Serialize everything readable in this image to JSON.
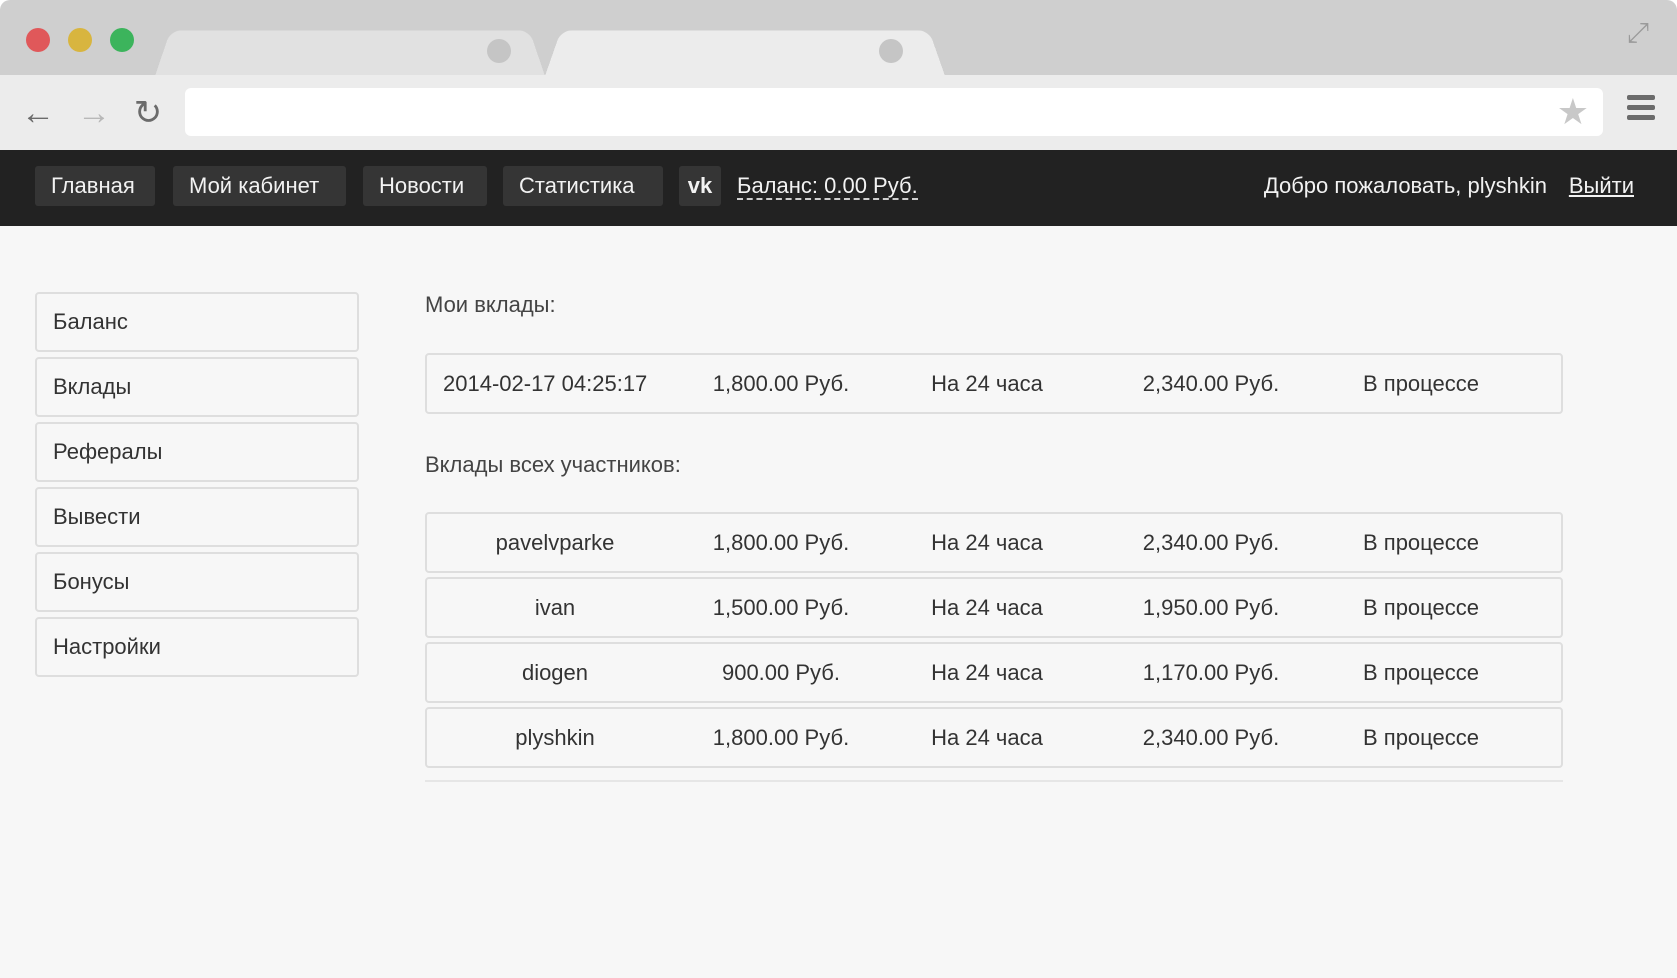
{
  "nav": {
    "home": "Главная",
    "cabinet": "Мой кабинет",
    "news": "Новости",
    "stats": "Статистика",
    "vk": "vk",
    "balance": "Баланс: 0.00 Руб.",
    "welcome": "Добро пожаловать, plyshkin",
    "logout": "Выйти"
  },
  "sidebar": {
    "items": [
      {
        "label": "Баланс"
      },
      {
        "label": "Вклады"
      },
      {
        "label": "Рефералы"
      },
      {
        "label": "Вывести"
      },
      {
        "label": "Бонусы"
      },
      {
        "label": "Настройки"
      }
    ]
  },
  "my_deposits": {
    "title": "Мои вклады:",
    "rows": [
      {
        "date": "2014-02-17 04:25:17",
        "amount": "1,800.00 Руб.",
        "term": "На 24 часа",
        "payout": "2,340.00 Руб.",
        "status": "В процессе"
      }
    ]
  },
  "all_deposits": {
    "title": "Вклады всех участников:",
    "rows": [
      {
        "user": "pavelvparke",
        "amount": "1,800.00 Руб.",
        "term": "На 24 часа",
        "payout": "2,340.00 Руб.",
        "status": "В процессе"
      },
      {
        "user": "ivan",
        "amount": "1,500.00 Руб.",
        "term": "На 24 часа",
        "payout": "1,950.00 Руб.",
        "status": "В процессе"
      },
      {
        "user": "diogen",
        "amount": "900.00 Руб.",
        "term": "На 24 часа",
        "payout": "1,170.00 Руб.",
        "status": "В процессе"
      },
      {
        "user": "plyshkin",
        "amount": "1,800.00 Руб.",
        "term": "На 24 часа",
        "payout": "2,340.00 Руб.",
        "status": "В процессе"
      }
    ]
  },
  "icons": [
    "back-arrow-icon",
    "forward-arrow-icon",
    "reload-icon",
    "star-icon",
    "menu-icon",
    "expand-icon",
    "vk-icon"
  ]
}
